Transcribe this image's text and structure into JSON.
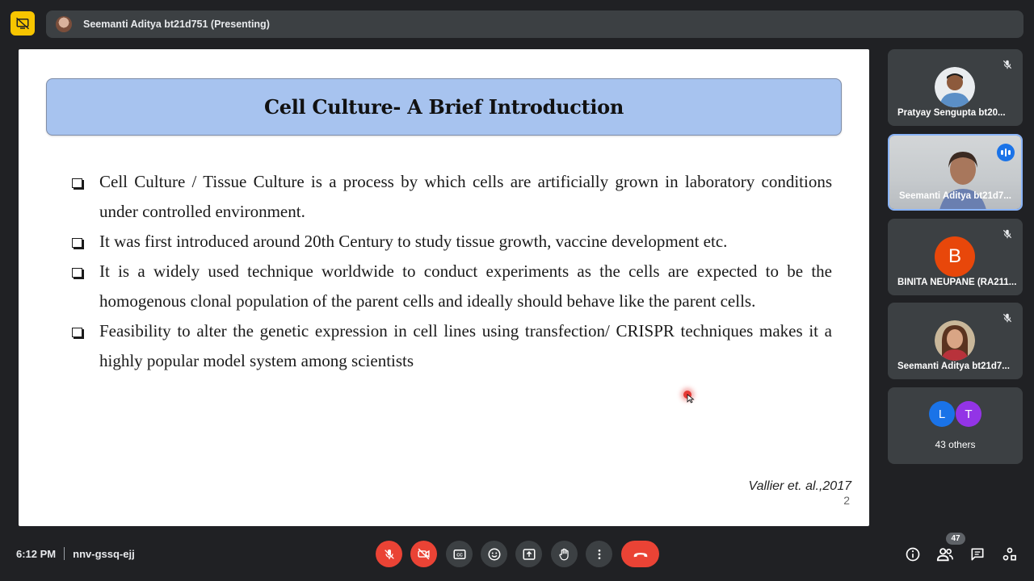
{
  "header": {
    "presenting_label": "Seemanti Aditya bt21d751 (Presenting)"
  },
  "slide": {
    "title": "Cell Culture- A Brief Introduction",
    "bullets": [
      "Cell Culture / Tissue Culture is a process by which cells are artificially grown in laboratory conditions under controlled environment.",
      "It was first introduced around 20th Century to study tissue growth, vaccine development etc.",
      "It is a widely used technique worldwide to conduct experiments as the cells are expected to be the homogenous clonal population of the parent cells and ideally should behave like the parent cells.",
      "Feasibility to alter the genetic expression in cell lines using transfection/ CRISPR techniques makes it a highly popular model system among scientists"
    ],
    "citation": "Vallier et. al.,2017",
    "page_number": "2"
  },
  "participants": [
    {
      "name": "Pratyay Sengupta bt20...",
      "muted": true
    },
    {
      "name": "Seemanti Aditya bt21d7...",
      "speaking": true
    },
    {
      "name": "BINITA NEUPANE (RA211...",
      "initial": "B",
      "muted": true
    },
    {
      "name": "Seemanti Aditya bt21d7...",
      "muted": true
    }
  ],
  "others": {
    "initials": [
      "L",
      "T"
    ],
    "label": "43 others"
  },
  "footer": {
    "time": "6:12 PM",
    "meeting_code": "nnv-gssq-ejj",
    "people_count": "47"
  },
  "colors": {
    "bg": "#202124",
    "tile": "#3c4043",
    "danger": "#ea4335",
    "present_badge": "#f7c500",
    "title_box": "#a7c3ef",
    "avatar_b": "#e8470a",
    "avatar_l": "#1a73e8",
    "avatar_t": "#9334e6"
  }
}
